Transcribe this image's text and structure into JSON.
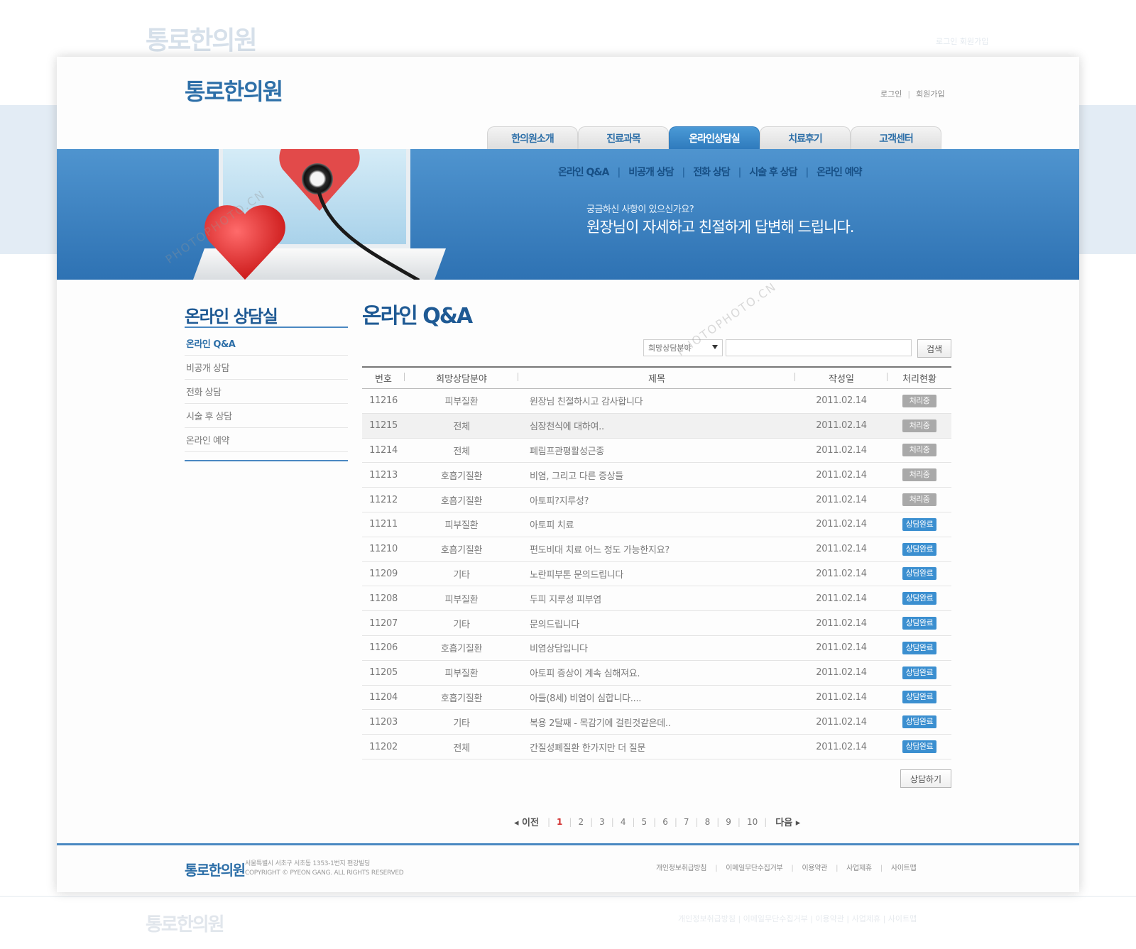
{
  "background": {
    "ghost_logo": "통로한의원",
    "ghost_top_links": "로그인   회원가입",
    "ghost_footer_logo": "통로한의원",
    "ghost_footer_links": "개인정보취급방침   |   이메일무단수집거부   |   이용약관   |   사업제휴   |   사이트맵"
  },
  "header": {
    "logo": "통로한의원",
    "login": "로그인",
    "signup": "회원가입"
  },
  "tabs": [
    {
      "label": "한의원소개"
    },
    {
      "label": "진료과목"
    },
    {
      "label": "온라인상담실"
    },
    {
      "label": "치료후기"
    },
    {
      "label": "고객센터"
    }
  ],
  "banner": {
    "subnav": [
      "온라인 Q&A",
      "비공개 상담",
      "전화 상담",
      "시술 후 상담",
      "온라인 예약"
    ],
    "question": "궁금하신 사항이 있으신가요?",
    "answer": "원장님이 자세하고 친절하게 답변해 드립니다."
  },
  "sidebar": {
    "title": "온라인 상담실",
    "items": [
      {
        "label": "온라인 Q&A"
      },
      {
        "label": "비공개 상담"
      },
      {
        "label": "전화 상담"
      },
      {
        "label": "시술 후 상담"
      },
      {
        "label": "온라인 예약"
      }
    ]
  },
  "content": {
    "title": "온라인 Q&A",
    "search_select": "희망상담분야",
    "search_button": "검색",
    "consult_button": "상담하기"
  },
  "table": {
    "headers": [
      "번호",
      "희망상담분야",
      "제목",
      "작성일",
      "처리현황"
    ],
    "rows": [
      {
        "num": "11216",
        "cat": "피부질환",
        "title": "원장님 친절하시고 감사합니다",
        "date": "2011.02.14",
        "status": "처리중"
      },
      {
        "num": "11215",
        "cat": "전체",
        "title": "심장천식에 대하여..",
        "date": "2011.02.14",
        "status": "처리중"
      },
      {
        "num": "11214",
        "cat": "전체",
        "title": "폐림프관평활성근종",
        "date": "2011.02.14",
        "status": "처리중"
      },
      {
        "num": "11213",
        "cat": "호흡기질환",
        "title": "비염, 그리고 다른 증상들",
        "date": "2011.02.14",
        "status": "처리중"
      },
      {
        "num": "11212",
        "cat": "호흡기질환",
        "title": "아토피?지루성?",
        "date": "2011.02.14",
        "status": "처리중"
      },
      {
        "num": "11211",
        "cat": "피부질환",
        "title": "아토피 치료",
        "date": "2011.02.14",
        "status": "상담완료"
      },
      {
        "num": "11210",
        "cat": "호흡기질환",
        "title": "편도비대 치료 어느 정도 가능한지요?",
        "date": "2011.02.14",
        "status": "상담완료"
      },
      {
        "num": "11209",
        "cat": "기타",
        "title": "노란피부톤 문의드립니다",
        "date": "2011.02.14",
        "status": "상담완료"
      },
      {
        "num": "11208",
        "cat": "피부질환",
        "title": "두피 지루성 피부염",
        "date": "2011.02.14",
        "status": "상담완료"
      },
      {
        "num": "11207",
        "cat": "기타",
        "title": "문의드립니다",
        "date": "2011.02.14",
        "status": "상담완료"
      },
      {
        "num": "11206",
        "cat": "호흡기질환",
        "title": "비염상담입니다",
        "date": "2011.02.14",
        "status": "상담완료"
      },
      {
        "num": "11205",
        "cat": "피부질환",
        "title": "아토피 증상이 계속 심해져요.",
        "date": "2011.02.14",
        "status": "상담완료"
      },
      {
        "num": "11204",
        "cat": "호흡기질환",
        "title": "아들(8세) 비염이 심합니다....",
        "date": "2011.02.14",
        "status": "상담완료"
      },
      {
        "num": "11203",
        "cat": "기타",
        "title": "복용 2달째 - 목감기에 걸린것같은데..",
        "date": "2011.02.14",
        "status": "상담완료"
      },
      {
        "num": "11202",
        "cat": "전체",
        "title": "간질성폐질환 한가지만 더 질문",
        "date": "2011.02.14",
        "status": "상담완료"
      }
    ]
  },
  "pager": {
    "prev": "◂ 이전",
    "pages": [
      "1",
      "2",
      "3",
      "4",
      "5",
      "6",
      "7",
      "8",
      "9",
      "10"
    ],
    "current": "1",
    "next": "다음 ▸"
  },
  "footer": {
    "logo": "통로한의원",
    "address": "서울특별시 서초구 서초동 1353-1번지 편강빌딩",
    "copyright": "COPYRIGHT © PYEON GANG. ALL RIGHTS RESERVED",
    "links": [
      "개인정보취급방침",
      "이메일무단수집거부",
      "이용약관",
      "사업제휴",
      "사이트맵"
    ]
  },
  "watermark": "PHOTOPHOTO.CN",
  "colors": {
    "brand_blue": "#2d6fa8",
    "banner_blue": "#3a82c2",
    "status_pending": "#a9a9a9",
    "status_done": "#3b8fd0",
    "current_page": "#d23030"
  }
}
